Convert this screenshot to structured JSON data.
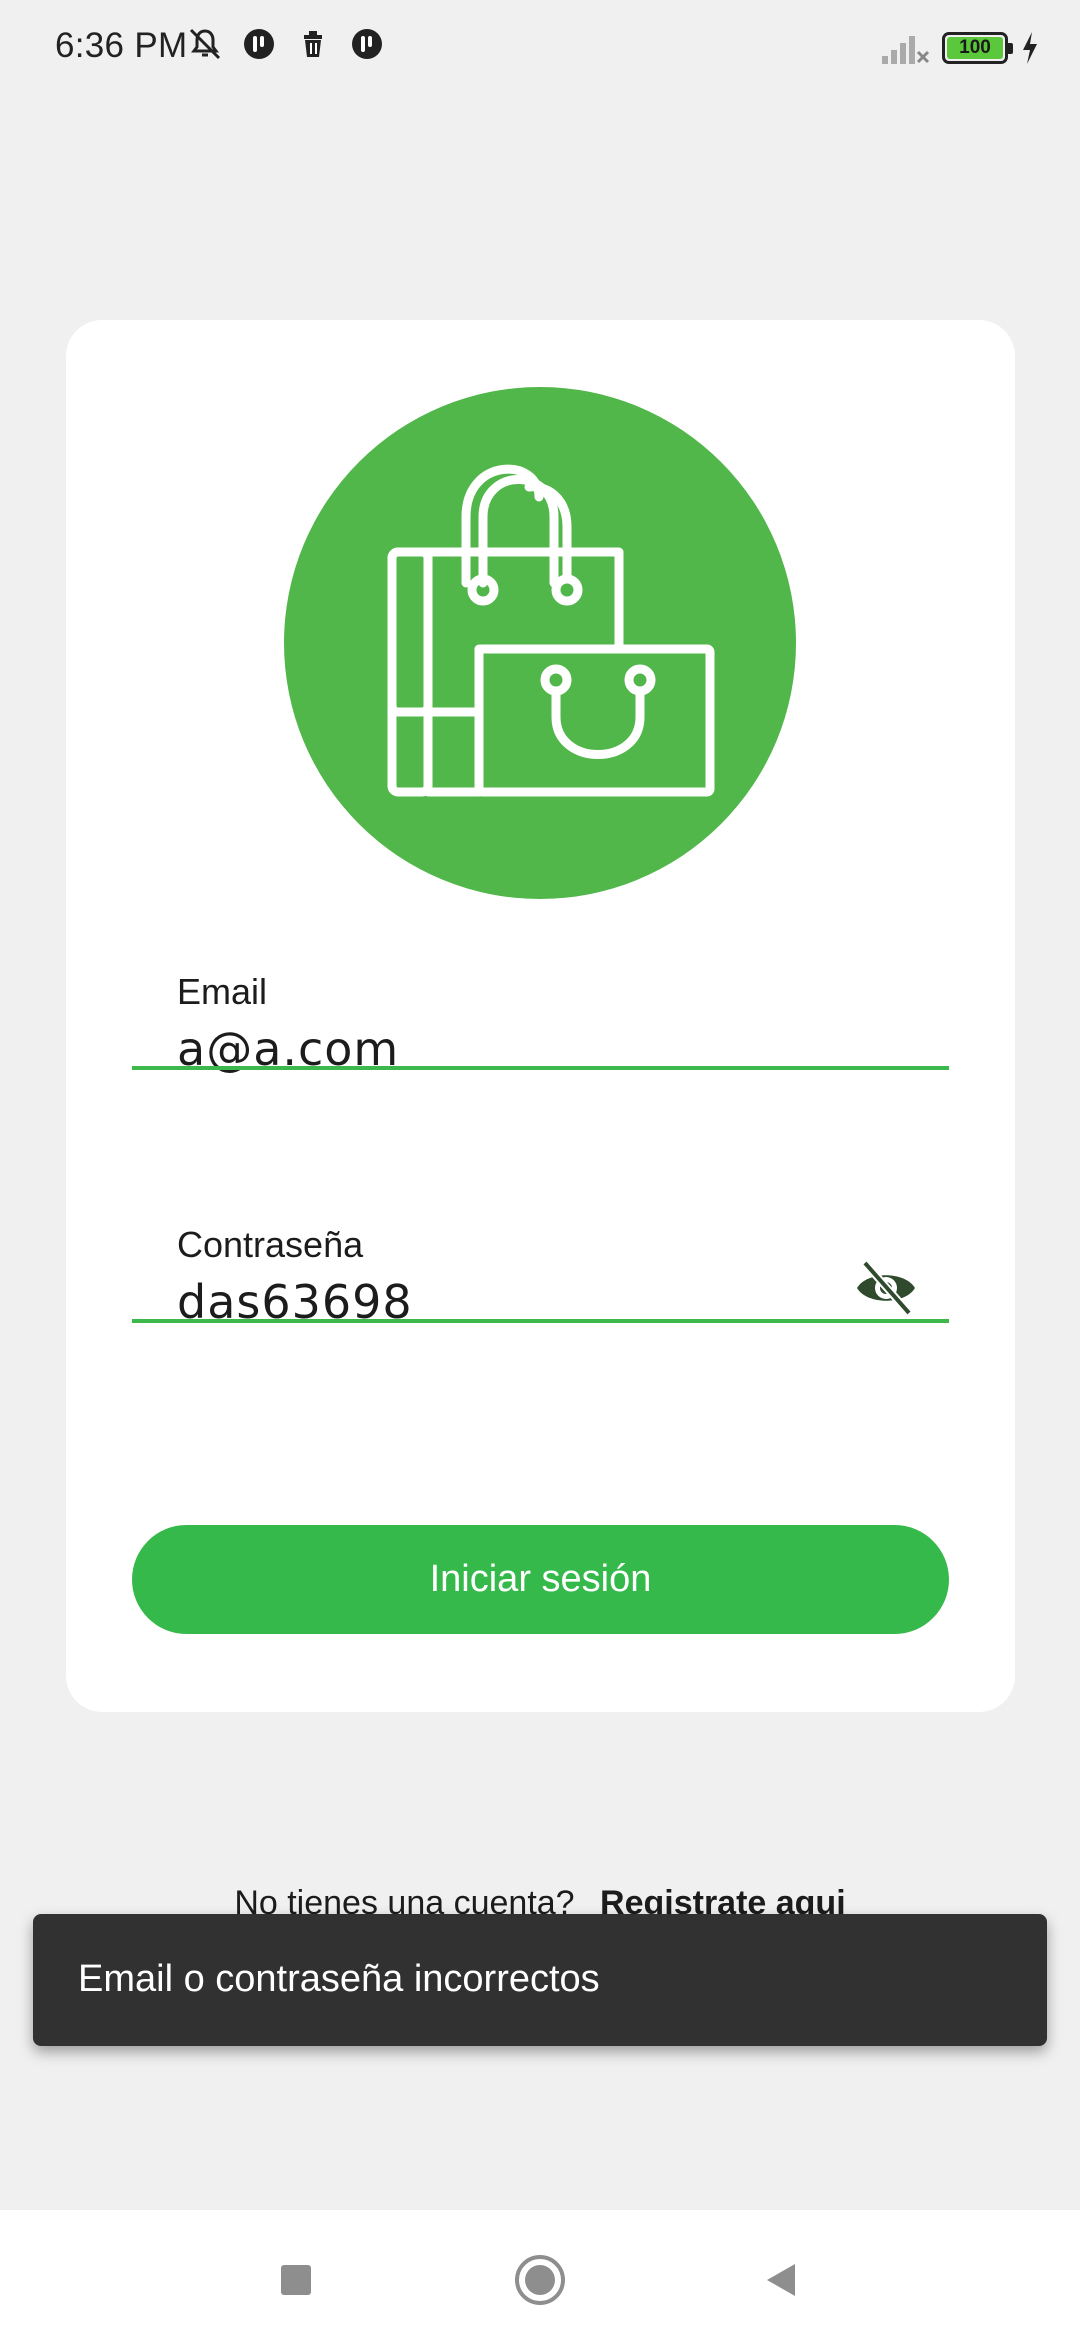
{
  "status_bar": {
    "time": "6:36 PM",
    "left_icons": [
      "mute-icon",
      "app-notification-icon",
      "trash-icon",
      "app-notification-icon"
    ],
    "right_icons": [
      "signal-icon",
      "battery-icon",
      "charging-icon"
    ],
    "battery_level": "100"
  },
  "login_card": {
    "logo_icon": "shopping-bags-icon",
    "email": {
      "label": "Email",
      "value": "a@a.com"
    },
    "password": {
      "label": "Contraseña",
      "value": "das63698",
      "visibility_icon": "eye-off-icon"
    },
    "login_button": "Iniciar sesión"
  },
  "register": {
    "prompt": "No tienes una cuenta?",
    "link": "Registrate aqui"
  },
  "snackbar": {
    "message": "Email o contraseña incorrectos"
  },
  "nav_bar": {
    "recents_icon": "square-icon",
    "home_icon": "circle-icon",
    "back_icon": "triangle-back-icon"
  },
  "colors": {
    "background": "#f0f0f0",
    "card": "#ffffff",
    "logo_circle": "#52b74a",
    "accent_green": "#36b94b",
    "underline": "#3db84b",
    "snackbar": "#313131"
  }
}
